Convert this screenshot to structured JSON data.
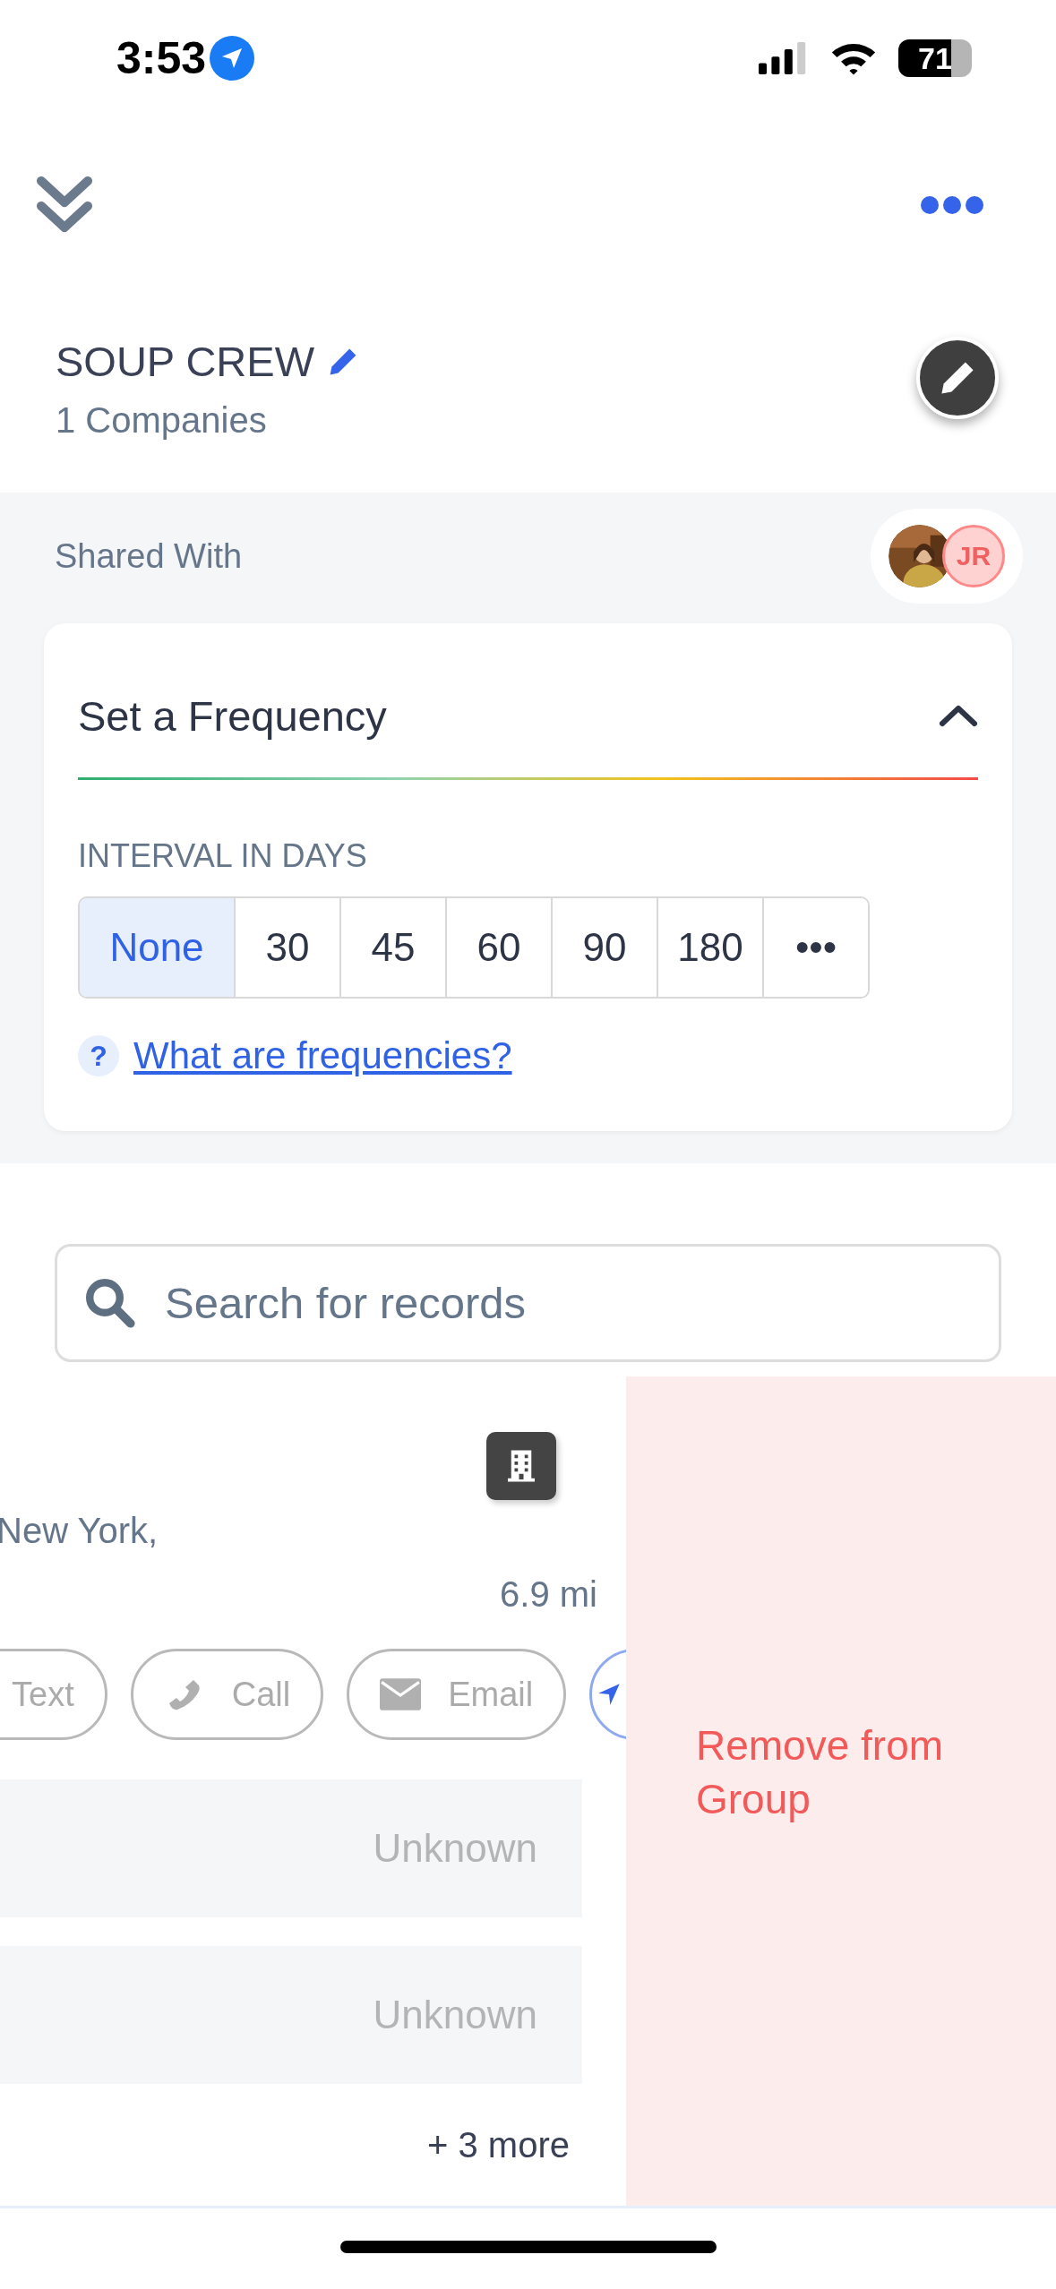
{
  "status_bar": {
    "time": "3:53",
    "battery": "71"
  },
  "header": {
    "title": "SOUP CREW",
    "subtitle": "1 Companies"
  },
  "shared": {
    "label": "Shared With",
    "avatars": [
      {
        "kind": "picture"
      },
      {
        "kind": "initials",
        "initials": "JR"
      }
    ]
  },
  "frequency": {
    "title": "Set a Frequency",
    "expanded": true,
    "interval_label": "INTERVAL IN DAYS",
    "options": [
      {
        "label": "None",
        "selected": true
      },
      {
        "label": "30",
        "selected": false
      },
      {
        "label": "45",
        "selected": false
      },
      {
        "label": "60",
        "selected": false
      },
      {
        "label": "90",
        "selected": false
      },
      {
        "label": "180",
        "selected": false
      },
      {
        "label": "•••",
        "selected": false
      }
    ],
    "help_icon": "?",
    "help_link": "What are frequencies?"
  },
  "search": {
    "placeholder": "Search for records"
  },
  "record": {
    "location": "New York,",
    "distance": "6.9 mi",
    "actions": [
      {
        "kind": "text",
        "label": "Text"
      },
      {
        "kind": "call",
        "label": "Call"
      },
      {
        "kind": "email",
        "label": "Email"
      },
      {
        "kind": "navigate"
      }
    ],
    "fields": [
      {
        "value": "Unknown"
      },
      {
        "value": "Unknown"
      }
    ],
    "more": "+ 3 more",
    "swipe_action": "Remove from Group"
  }
}
